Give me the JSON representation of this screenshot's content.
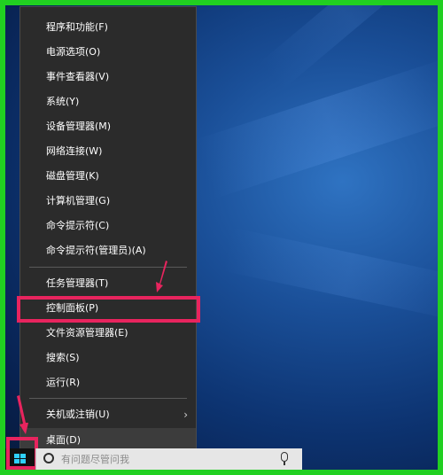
{
  "menu": {
    "items": [
      {
        "label": "程序和功能(F)"
      },
      {
        "label": "电源选项(O)"
      },
      {
        "label": "事件查看器(V)"
      },
      {
        "label": "系统(Y)"
      },
      {
        "label": "设备管理器(M)"
      },
      {
        "label": "网络连接(W)"
      },
      {
        "label": "磁盘管理(K)"
      },
      {
        "label": "计算机管理(G)"
      },
      {
        "label": "命令提示符(C)"
      },
      {
        "label": "命令提示符(管理员)(A)"
      },
      {
        "label": "任务管理器(T)"
      },
      {
        "label": "控制面板(P)"
      },
      {
        "label": "文件资源管理器(E)"
      },
      {
        "label": "搜索(S)"
      },
      {
        "label": "运行(R)"
      },
      {
        "label": "关机或注销(U)"
      },
      {
        "label": "桌面(D)"
      }
    ]
  },
  "taskbar": {
    "search_placeholder": "有问题尽管问我"
  },
  "colors": {
    "highlight": "#e8245e",
    "arrow": "#e8245e",
    "frame": "#21d021",
    "menu_bg": "#2b2b2b"
  }
}
